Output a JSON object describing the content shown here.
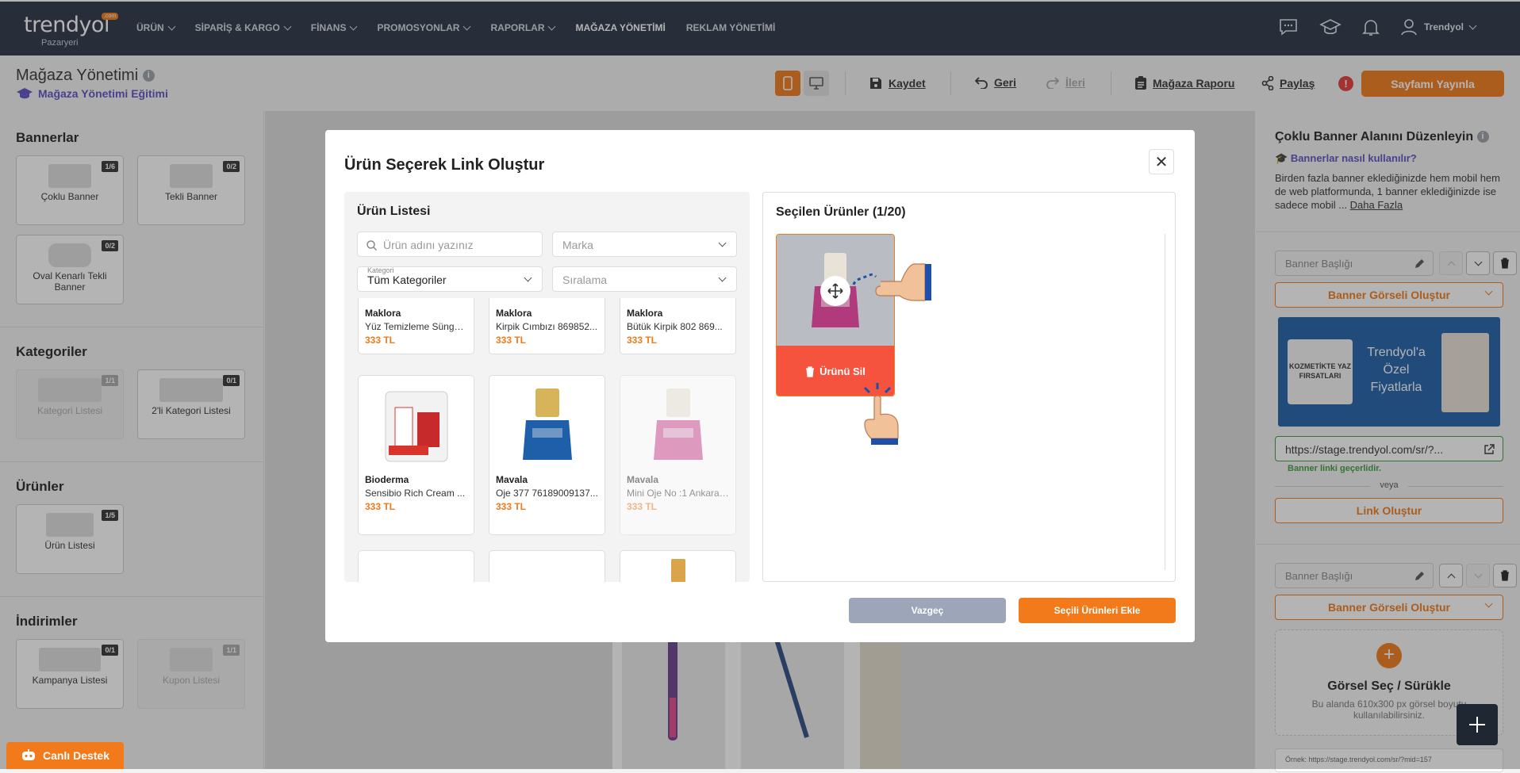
{
  "brand": {
    "name": "trendyol",
    "sub": "Pazaryeri",
    "badge": ".com"
  },
  "menu": [
    {
      "label": "ÜRÜN"
    },
    {
      "label": "SİPARİŞ & KARGO"
    },
    {
      "label": "FİNANS"
    },
    {
      "label": "PROMOSYONLAR"
    },
    {
      "label": "RAPORLAR"
    },
    {
      "label": "MAĞAZA YÖNETİMİ"
    },
    {
      "label": "REKLAM YÖNETİMİ"
    }
  ],
  "user": {
    "name": "Trendyol"
  },
  "toolbar": {
    "title": "Mağaza Yönetimi",
    "edu_link": "Mağaza Yönetimi Eğitimi",
    "save": "Kaydet",
    "back": "Geri",
    "forward": "İleri",
    "report": "Mağaza Raporu",
    "share": "Paylaş",
    "publish": "Sayfamı Yayınla"
  },
  "left": {
    "banners_title": "Bannerlar",
    "categories_title": "Kategoriler",
    "products_title": "Ürünler",
    "discounts_title": "İndirimler",
    "cards": {
      "multi": {
        "label": "Çoklu Banner",
        "badge": "1/6"
      },
      "single": {
        "label": "Tekli Banner",
        "badge": "0/2"
      },
      "oval": {
        "label": "Oval Kenarlı Tekli Banner",
        "badge": "0/2"
      },
      "catlist": {
        "label": "Kategori Listesi",
        "badge": "1/1"
      },
      "cat2": {
        "label": "2'li Kategori Listesi",
        "badge": "0/1"
      },
      "prodlist": {
        "label": "Ürün Listesi",
        "badge": "1/5"
      },
      "campaign": {
        "label": "Kampanya Listesi",
        "badge": "0/1"
      },
      "coupon": {
        "label": "Kupon Listesi",
        "badge": "1/1"
      }
    }
  },
  "right": {
    "title": "Çoklu Banner Alanını Düzenleyin",
    "help": "Bannerlar nasıl kullanılır?",
    "desc": "Birden fazla banner eklediğinizde hem mobil hem de web platformunda, 1 banner eklediğinizde ise sadece mobil ...",
    "more": "Daha Fazla",
    "banner_title_ph": "Banner Başlığı",
    "create_visual": "Banner Görseli Oluştur",
    "url": "https://stage.trendyol.com/sr/?...",
    "valid": "Banner linki geçerlidir.",
    "or": "veya",
    "create_link": "Link Oluştur",
    "banner_text_left": "KOZMETİKTE YAZ FIRSATLARI",
    "banner_text_right": "Trendyol'a Özel Fiyatlarla",
    "upload_title": "Görsel Seç / Sürükle",
    "upload_desc": "Bu alanda 610x300 px görsel boyutu kullanılabilirsiniz.",
    "example": "Örnek: https://stage.trendyol.com/sr/?mid=157"
  },
  "modal": {
    "title": "Ürün Seçerek Link Oluştur",
    "list_title": "Ürün Listesi",
    "search_ph": "Ürün adını yazınız",
    "brand_ph": "Marka",
    "cat_label": "Kategori",
    "cat_value": "Tüm Kategoriler",
    "sort_ph": "Sıralama",
    "selected_title": "Seçilen Ürünler (1/20)",
    "delete_label": "Ürünü Sil",
    "cancel": "Vazgeç",
    "add": "Seçili Ürünleri Ekle",
    "products_row1": [
      {
        "brand": "Maklora",
        "name": "Yüz Temizleme Sünger...",
        "price": "333 TL"
      },
      {
        "brand": "Maklora",
        "name": "Kirpik Cımbızı 869852...",
        "price": "333 TL"
      },
      {
        "brand": "Maklora",
        "name": "Bütük Kirpik 802 869...",
        "price": "333 TL"
      }
    ],
    "products_row2": [
      {
        "brand": "Bioderma",
        "name": "Sensibio Rich Cream ...",
        "price": "333 TL"
      },
      {
        "brand": "Mavala",
        "name": "Oje 377 76189009137...",
        "price": "333 TL"
      },
      {
        "brand": "Mavala",
        "name": "Mini Oje No :1 Ankara ...",
        "price": "333 TL"
      }
    ]
  },
  "support": {
    "label": "Canlı Destek"
  },
  "colors": {
    "accent": "#f27a1a",
    "nav": "#273142",
    "link": "#5b4fc2",
    "danger": "#f5533d"
  }
}
